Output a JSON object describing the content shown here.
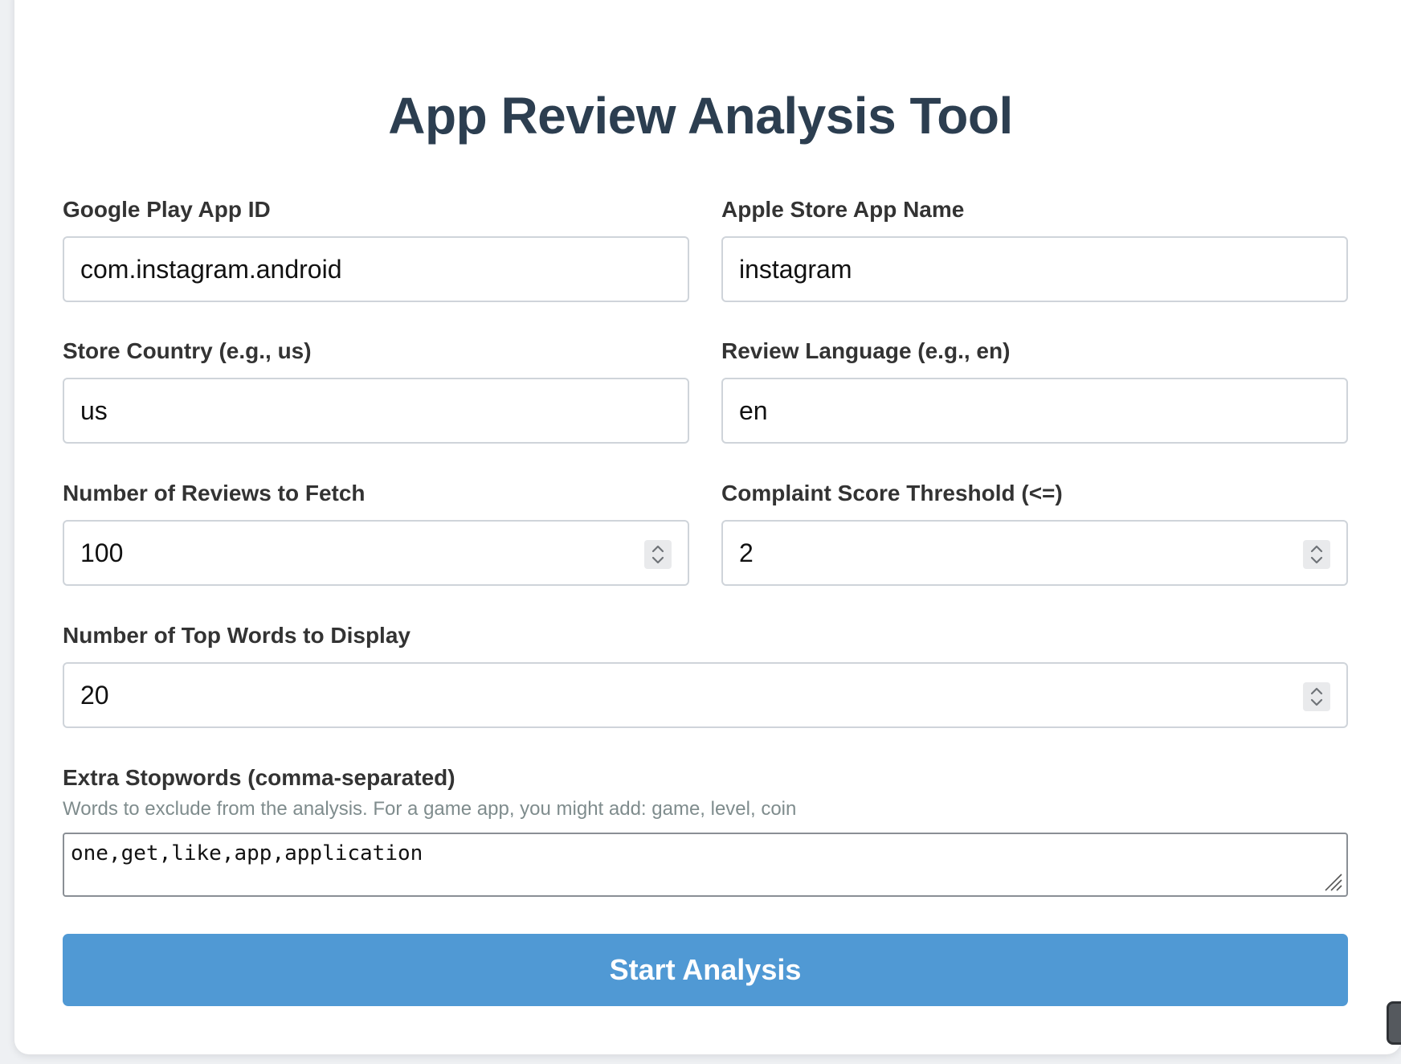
{
  "page": {
    "title": "App Review Analysis Tool"
  },
  "form": {
    "google_play_app_id": {
      "label": "Google Play App ID",
      "value": "com.instagram.android"
    },
    "apple_store_app_name": {
      "label": "Apple Store App Name",
      "value": "instagram"
    },
    "store_country": {
      "label": "Store Country (e.g., us)",
      "value": "us"
    },
    "review_language": {
      "label": "Review Language (e.g., en)",
      "value": "en"
    },
    "num_reviews": {
      "label": "Number of Reviews to Fetch",
      "value": "100"
    },
    "complaint_threshold": {
      "label": "Complaint Score Threshold (<=)",
      "value": "2"
    },
    "top_words": {
      "label": "Number of Top Words to Display",
      "value": "20"
    },
    "extra_stopwords": {
      "label": "Extra Stopwords (comma-separated)",
      "hint": "Words to exclude from the analysis. For a game app, you might add: game, level, coin",
      "value": "one,get,like,app,application"
    }
  },
  "actions": {
    "start_label": "Start Analysis"
  },
  "colors": {
    "title": "#2c3e50",
    "button": "#5099d4",
    "hint": "#7f8c8d"
  }
}
